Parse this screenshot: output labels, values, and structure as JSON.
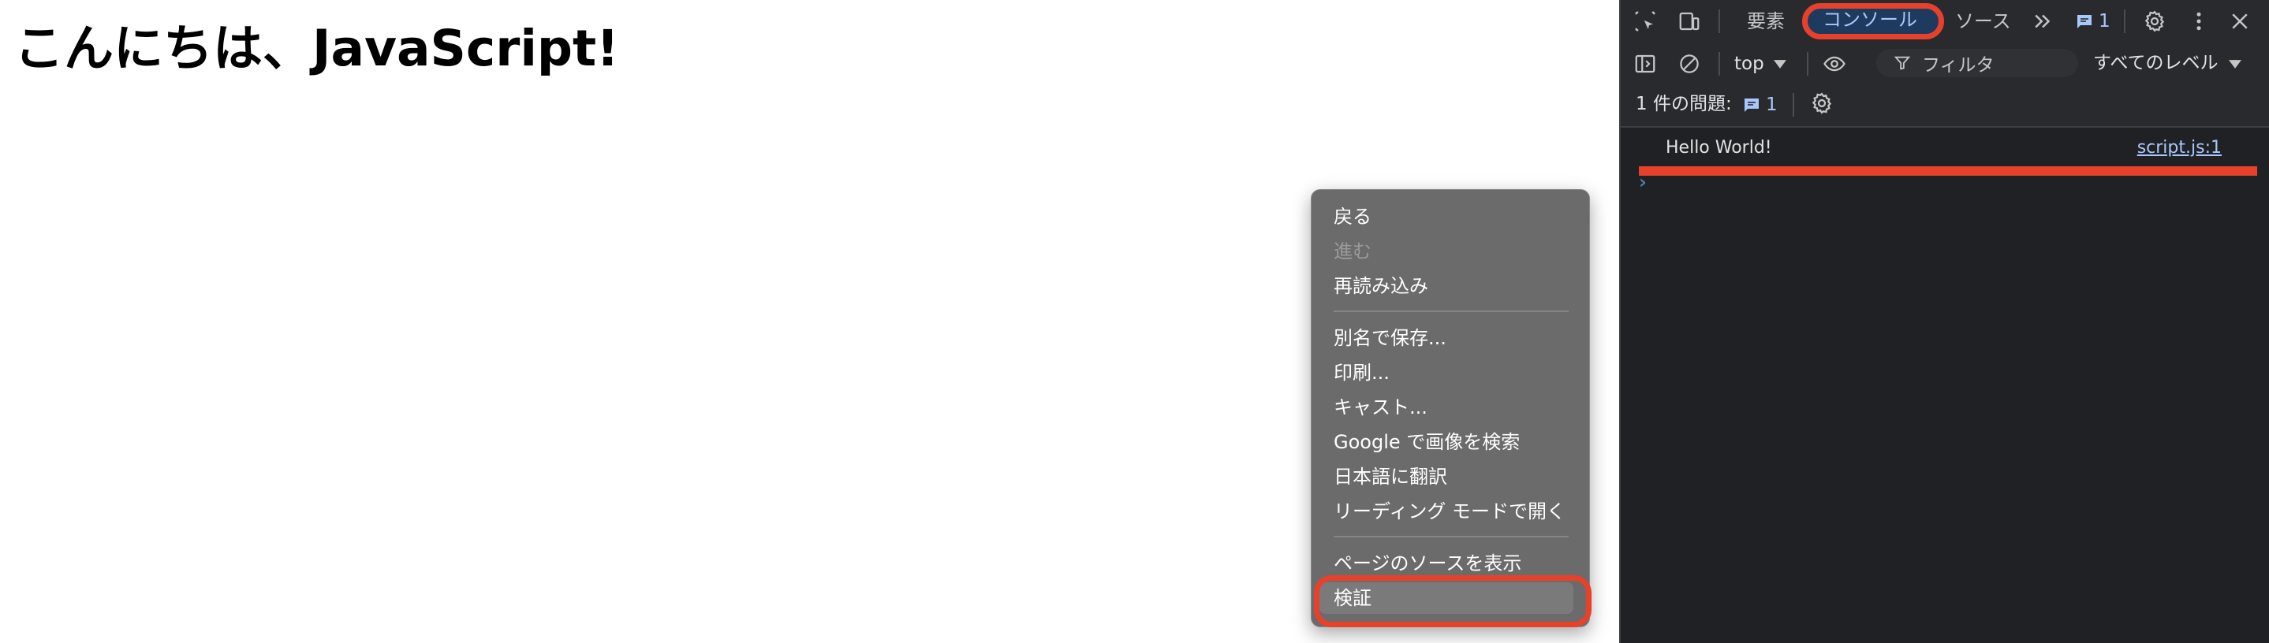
{
  "page": {
    "heading": "こんにちは、JavaScript!"
  },
  "context_menu": {
    "items": [
      {
        "label": "戻る",
        "enabled": true
      },
      {
        "label": "進む",
        "enabled": false
      },
      {
        "label": "再読み込み",
        "enabled": true
      },
      {
        "label": "別名で保存...",
        "enabled": true
      },
      {
        "label": "印刷...",
        "enabled": true
      },
      {
        "label": "キャスト...",
        "enabled": true
      },
      {
        "label": "Google で画像を検索",
        "enabled": true
      },
      {
        "label": "日本語に翻訳",
        "enabled": true
      },
      {
        "label": "リーディング モードで開く",
        "enabled": true
      },
      {
        "label": "ページのソースを表示",
        "enabled": true
      },
      {
        "label": "検証",
        "enabled": true,
        "highlighted": true
      }
    ],
    "highlight_color": "#e8412b"
  },
  "devtools": {
    "tabs": {
      "elements": "要素",
      "console": "コンソール",
      "sources": "ソース",
      "active": "コンソール"
    },
    "issues_badge_count": "1",
    "toolbar": {
      "context": "top",
      "filter_placeholder": "フィルタ",
      "levels": "すべてのレベル"
    },
    "issues_bar": {
      "label": "1 件の問題:",
      "count": "1"
    },
    "console": {
      "messages": [
        {
          "text": "Hello World!",
          "source": "script.js:1"
        }
      ],
      "prompt": "›"
    },
    "icons": {
      "inspect": "inspect-element-icon",
      "device": "device-toolbar-icon",
      "more_tabs": "chevron-double-right-icon",
      "issues": "message-icon",
      "settings": "gear-icon",
      "kebab": "more-vertical-icon",
      "close": "close-icon",
      "sidebar": "sidebar-toggle-icon",
      "clear": "clear-console-icon",
      "eye": "eye-icon",
      "filter": "filter-icon",
      "dropdown": "caret-down-icon"
    },
    "colors": {
      "background": "#202124",
      "accent": "#a8c7fa",
      "highlight": "#e8412b"
    }
  }
}
